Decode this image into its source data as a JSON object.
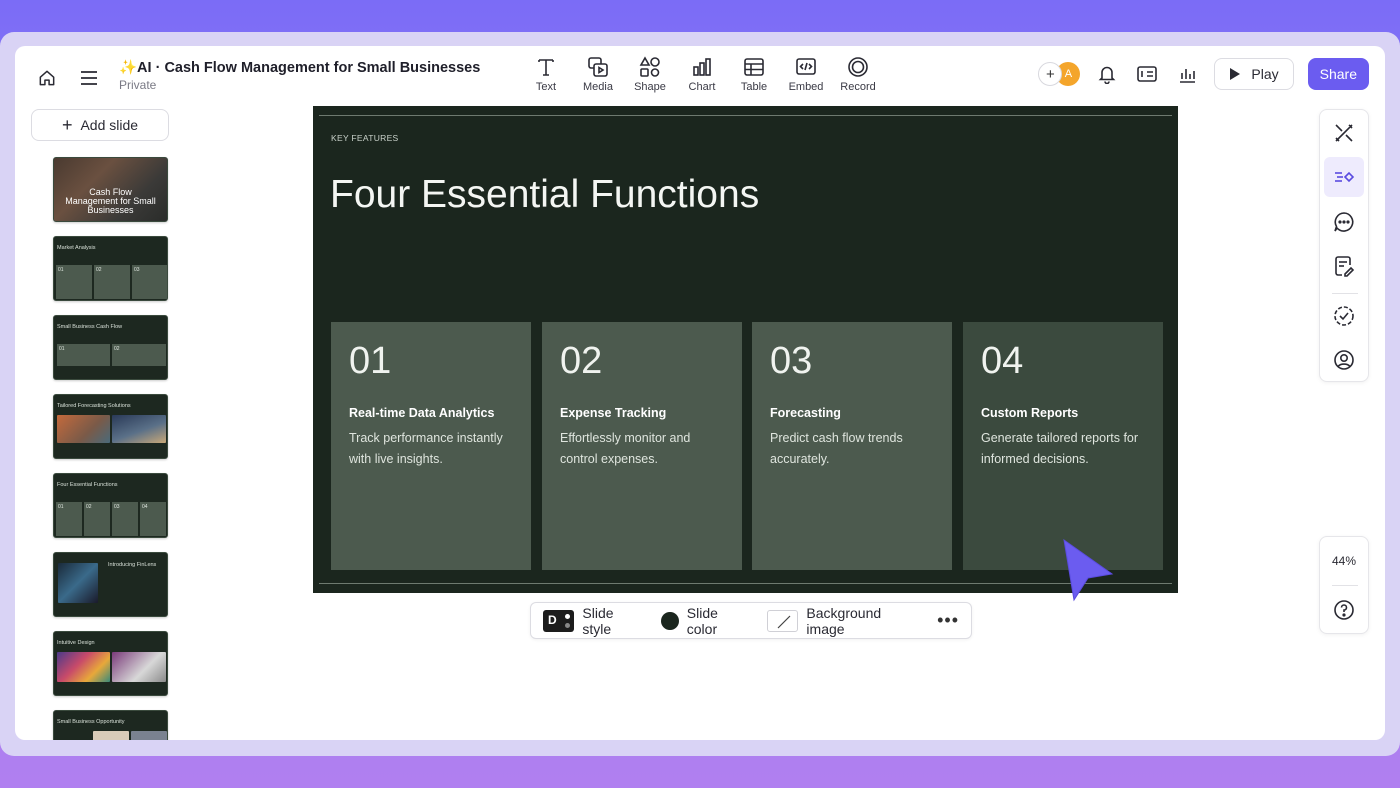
{
  "header": {
    "title": "✨AI · Cash Flow Management for Small Businesses",
    "visibility": "Private"
  },
  "tools": [
    {
      "label": "Text",
      "icon": "text-icon"
    },
    {
      "label": "Media",
      "icon": "media-icon"
    },
    {
      "label": "Shape",
      "icon": "shape-icon"
    },
    {
      "label": "Chart",
      "icon": "chart-icon"
    },
    {
      "label": "Table",
      "icon": "table-icon"
    },
    {
      "label": "Embed",
      "icon": "embed-icon"
    },
    {
      "label": "Record",
      "icon": "record-icon"
    }
  ],
  "top_right": {
    "avatar_initial": "A",
    "add_collaborator": "+",
    "play_label": "Play",
    "share_label": "Share"
  },
  "sidebar": {
    "add_slide_label": "Add slide",
    "thumbnails": [
      {
        "title": "Cash Flow Management for Small Businesses"
      },
      {
        "title": "Market Analysis",
        "nums": [
          "01",
          "02",
          "03"
        ]
      },
      {
        "title": "Small Business Cash Flow",
        "nums": [
          "01",
          "02"
        ]
      },
      {
        "title": "Tailored Forecasting Solutions"
      },
      {
        "title": "Four Essential Functions",
        "nums": [
          "01",
          "02",
          "03",
          "04"
        ]
      },
      {
        "title": "Introducing FinLens"
      },
      {
        "title": "Intuitive Design"
      },
      {
        "title": "Small Business Opportunity"
      }
    ]
  },
  "slide": {
    "kicker": "KEY FEATURES",
    "heading": "Four Essential Functions",
    "cards": [
      {
        "num": "01",
        "title": "Real-time Data Analytics",
        "desc": "Track performance instantly with live insights."
      },
      {
        "num": "02",
        "title": "Expense Tracking",
        "desc": "Effortlessly monitor and control expenses."
      },
      {
        "num": "03",
        "title": "Forecasting",
        "desc": "Predict cash flow trends accurately."
      },
      {
        "num": "04",
        "title": "Custom Reports",
        "desc": "Generate tailored reports for informed decisions."
      }
    ],
    "background_color": "#1b261e",
    "card_color": "#4c5a4e"
  },
  "slide_toolbar": {
    "style_badge": "D",
    "style_label": "Slide style",
    "color_label": "Slide color",
    "bg_label": "Background image",
    "more": "•••"
  },
  "zoom": {
    "level": "44%"
  },
  "colors": {
    "accent": "#6b5cf0",
    "cursor": "#6b5cf0"
  }
}
